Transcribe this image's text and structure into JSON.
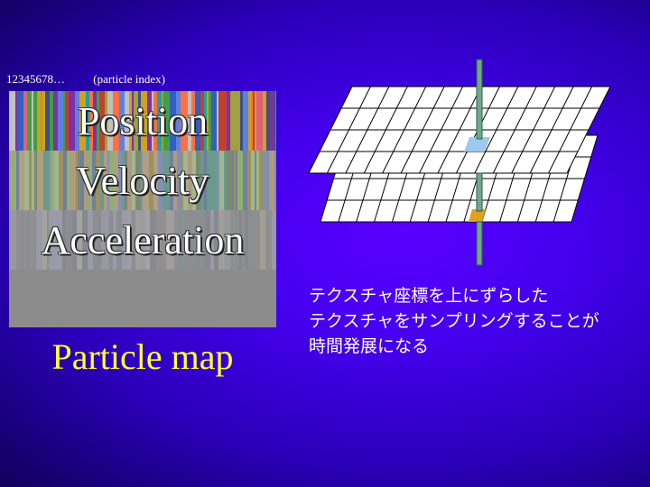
{
  "labels": {
    "index_numbers": "12345678…",
    "index_caption": "(particle index)"
  },
  "particle_map": {
    "rows": [
      {
        "label": "Position"
      },
      {
        "label": "Velocity"
      },
      {
        "label": "Acceleration"
      },
      {
        "label": ""
      }
    ],
    "caption": "Particle map"
  },
  "description": {
    "lines": [
      "テクスチャ座標を上にずらした",
      "テクスチャをサンプリングすることが",
      "時間発展になる"
    ]
  },
  "colors": {
    "caption": "#ffff33",
    "grid_fill": "#ffffff",
    "grid_line": "#000000",
    "rod": "#6fa88a",
    "highlight_top": "#9ec8f0",
    "highlight_bottom": "#e0a020"
  }
}
